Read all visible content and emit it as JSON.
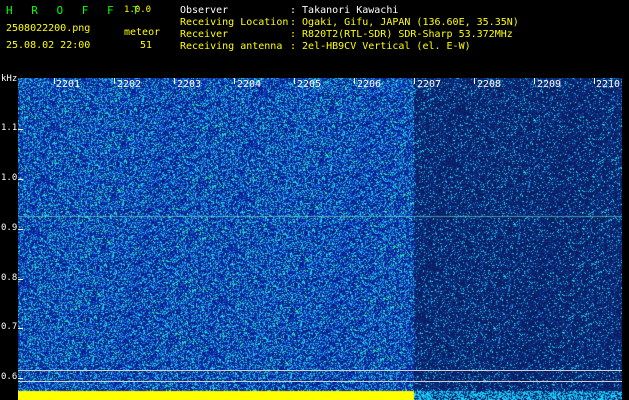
{
  "header": {
    "app_name": "H R O F F T",
    "version": "1.0.0",
    "file_name": "2508022200.png",
    "datetime": "25.08.02 22:00",
    "meteor_label": "meteor",
    "meteor_count": "51",
    "info": [
      {
        "label": "Observer",
        "value": ": Takanori Kawachi"
      },
      {
        "label": "Receiving Location",
        "value": ": Ogaki, Gifu, JAPAN (136.60E, 35.35N)"
      },
      {
        "label": "Receiver",
        "value": ": R820T2(RTL-SDR) SDR-Sharp 53.372MHz"
      },
      {
        "label": "Receiving antenna",
        "value": ": 2el-HB9CV Vertical (el. E-W)"
      }
    ]
  },
  "spectrogram": {
    "y_unit": "kHz",
    "y_ticks": [
      "1.1",
      "1.0",
      "0.9",
      "0.8",
      "0.7",
      "0.6"
    ],
    "x_ticks": [
      "2201",
      "2202",
      "2203",
      "2204",
      "2205",
      "2206",
      "2207",
      "2208",
      "2209",
      "2210"
    ],
    "colors": {
      "background": "#000000",
      "noise_low": "#0c2a8a",
      "noise_high": "#16c8ff",
      "peak": "#00ff88",
      "bottom_signal": "#ffff00"
    }
  }
}
